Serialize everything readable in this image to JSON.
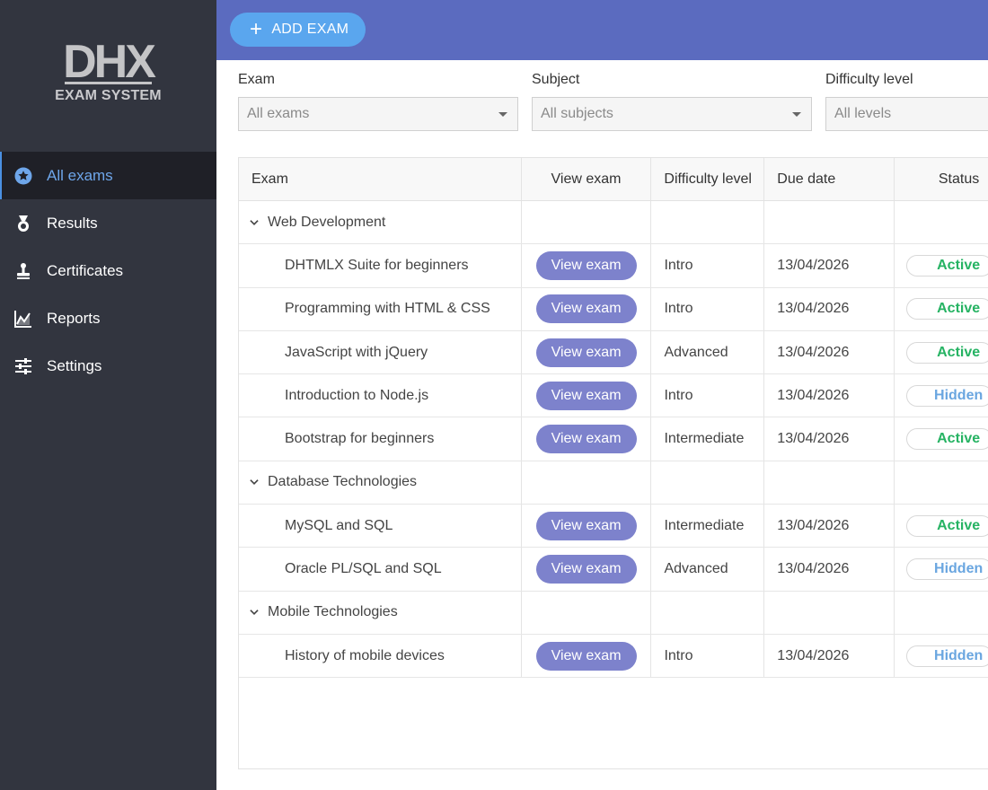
{
  "logo": {
    "mark": "DHX",
    "subtitle": "EXAM SYSTEM"
  },
  "sidebar": {
    "items": [
      {
        "label": "All exams",
        "icon": "star-circle-icon",
        "active": true
      },
      {
        "label": "Results",
        "icon": "medal-icon",
        "active": false
      },
      {
        "label": "Certificates",
        "icon": "stamp-icon",
        "active": false
      },
      {
        "label": "Reports",
        "icon": "chart-icon",
        "active": false
      },
      {
        "label": "Settings",
        "icon": "sliders-icon",
        "active": false
      }
    ]
  },
  "header": {
    "add_label": "ADD EXAM"
  },
  "filters": {
    "exam": {
      "label": "Exam",
      "value": "All exams"
    },
    "subject": {
      "label": "Subject",
      "value": "All subjects"
    },
    "difficulty": {
      "label": "Difficulty level",
      "value": "All levels"
    }
  },
  "grid": {
    "columns": [
      "Exam",
      "View exam",
      "Difficulty level",
      "Due date",
      "Status"
    ],
    "groups": [
      {
        "name": "Web Development",
        "rows": [
          {
            "exam": "DHTMLX Suite for beginners",
            "action": "View exam",
            "level": "Intro",
            "date": "13/04/2026",
            "status": "Active"
          },
          {
            "exam": "Programming with HTML & CSS",
            "action": "View exam",
            "level": "Intro",
            "date": "13/04/2026",
            "status": "Active"
          },
          {
            "exam": "JavaScript with jQuery",
            "action": "View exam",
            "level": "Advanced",
            "date": "13/04/2026",
            "status": "Active"
          },
          {
            "exam": "Introduction to Node.js",
            "action": "View exam",
            "level": "Intro",
            "date": "13/04/2026",
            "status": "Hidden"
          },
          {
            "exam": "Bootstrap for beginners",
            "action": "View exam",
            "level": "Intermediate",
            "date": "13/04/2026",
            "status": "Active"
          }
        ]
      },
      {
        "name": "Database Technologies",
        "rows": [
          {
            "exam": "MySQL and SQL",
            "action": "View exam",
            "level": "Intermediate",
            "date": "13/04/2026",
            "status": "Active"
          },
          {
            "exam": "Oracle PL/SQL and SQL",
            "action": "View exam",
            "level": "Advanced",
            "date": "13/04/2026",
            "status": "Hidden"
          }
        ]
      },
      {
        "name": "Mobile Technologies",
        "rows": [
          {
            "exam": "History of mobile devices",
            "action": "View exam",
            "level": "Intro",
            "date": "13/04/2026",
            "status": "Hidden"
          }
        ]
      }
    ]
  },
  "colors": {
    "sidebar_bg": "#32353f",
    "header_bg": "#5b6bbf",
    "accent": "#5aa6ee",
    "view_button": "#7d82cc",
    "status_active": "#26b363",
    "status_hidden": "#6aa6e0"
  }
}
